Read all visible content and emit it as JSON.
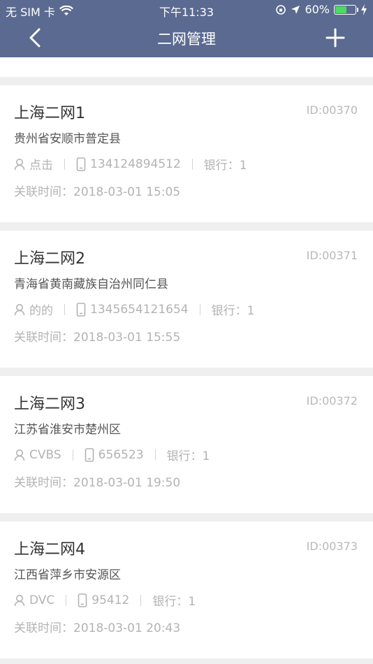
{
  "status": {
    "carrier": "无 SIM 卡",
    "time": "下午11:33",
    "battery_text": "60%",
    "battery_level": 0.6,
    "colors": {
      "battery": "#4cd964"
    }
  },
  "nav": {
    "title": "二网管理"
  },
  "theme": {
    "nav_bg": "#5b6a90"
  },
  "list": {
    "items": [
      {
        "name": "上海二网1",
        "id": "ID:00370",
        "address": "贵州省安顺市普定县",
        "contact": "点击",
        "phone": "134124894512",
        "bank": "银行：1",
        "time": "关联时间：2018-03-01 15:05"
      },
      {
        "name": "上海二网2",
        "id": "ID:00371",
        "address": "青海省黄南藏族自治州同仁县",
        "contact": "的的",
        "phone": "1345654121654",
        "bank": "银行：1",
        "time": "关联时间：2018-03-01 15:55"
      },
      {
        "name": "上海二网3",
        "id": "ID:00372",
        "address": "江苏省淮安市楚州区",
        "contact": "CVBS",
        "phone": "656523",
        "bank": "银行：1",
        "time": "关联时间：2018-03-01 19:50"
      },
      {
        "name": "上海二网4",
        "id": "ID:00373",
        "address": "江西省萍乡市安源区",
        "contact": "DVC",
        "phone": "95412",
        "bank": "银行：1",
        "time": "关联时间：2018-03-01 20:43"
      }
    ]
  }
}
